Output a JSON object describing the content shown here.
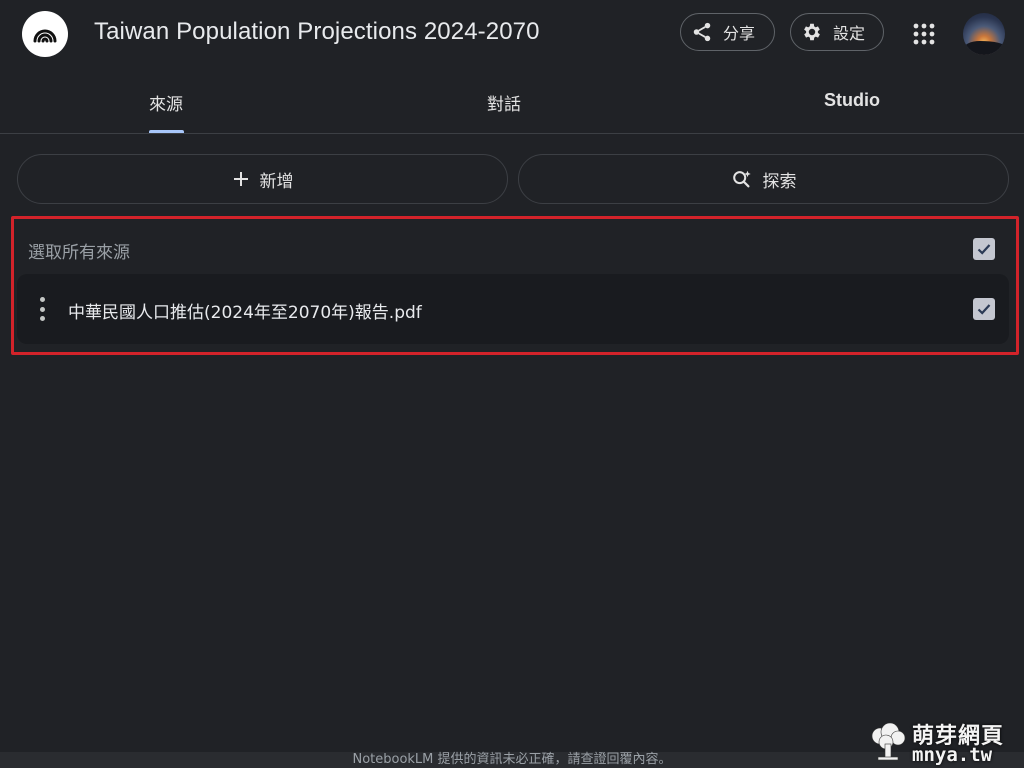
{
  "header": {
    "title": "Taiwan Population Projections 2024-2070",
    "share_label": "分享",
    "settings_label": "設定"
  },
  "tabs": [
    {
      "label": "來源",
      "active": true
    },
    {
      "label": "對話",
      "active": false
    },
    {
      "label": "Studio",
      "active": false
    }
  ],
  "actions": {
    "add_label": "新增",
    "discover_label": "探索"
  },
  "sources": {
    "select_all_label": "選取所有來源",
    "select_all_checked": true,
    "items": [
      {
        "name": "中華民國人口推估(2024年至2070年)報告.pdf",
        "checked": true
      }
    ]
  },
  "footer": {
    "disclaimer": "NotebookLM 提供的資訊未必正確，請查證回覆內容。"
  },
  "watermark": {
    "cn": "萌芽網頁",
    "en": "mnya.tw"
  },
  "colors": {
    "background": "#202226",
    "accent": "#a8c7fa",
    "highlight_border": "#d2232a",
    "checkbox": "#c4c7d0"
  },
  "icons": [
    "notebooklm-logo-icon",
    "share-icon",
    "gear-icon",
    "apps-grid-icon",
    "plus-icon",
    "discover-search-icon",
    "more-vert-icon",
    "check-icon"
  ]
}
